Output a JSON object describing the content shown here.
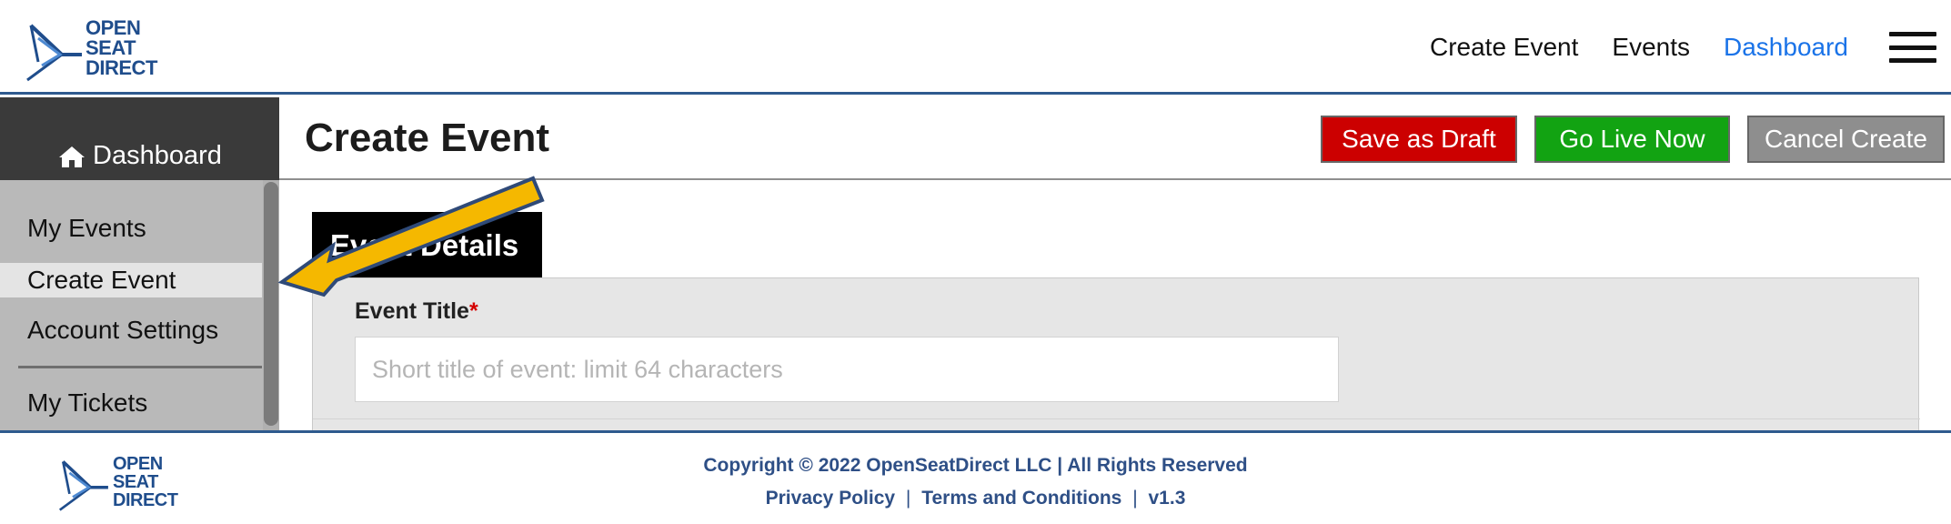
{
  "brand": {
    "logo_lines": [
      "OPEN",
      "SEAT",
      "DIRECT"
    ],
    "color": "#1f4d8c"
  },
  "topnav": {
    "items": [
      {
        "label": "Create Event"
      },
      {
        "label": "Events"
      },
      {
        "label": "Dashboard"
      }
    ],
    "active_color": "#1a73e8",
    "menu_icon": "hamburger-icon"
  },
  "sidebar": {
    "header_icon": "home-icon",
    "header_label": "Dashboard",
    "items": [
      {
        "label": "My Events"
      },
      {
        "label": "Create Event"
      },
      {
        "label": "Account Settings"
      },
      {
        "label": "My Tickets"
      }
    ],
    "active_item": "Create Event"
  },
  "main": {
    "title": "Create Event",
    "buttons": {
      "draft": "Save as Draft",
      "live": "Go Live Now",
      "cancel": "Cancel Create"
    },
    "button_colors": {
      "draft": "#cc0000",
      "live": "#12a312",
      "cancel": "#8e8e8e"
    },
    "section_tab": "Event Details",
    "event_title_label": "Event Title",
    "required_marker": "*",
    "event_title_placeholder": "Short title of event: limit 64 characters",
    "event_title_value": ""
  },
  "annotation": {
    "arrow_color": "#f5b800",
    "arrow_icon": "pointer-arrow-icon"
  },
  "footer": {
    "copyright": "Copyright © 2022 OpenSeatDirect LLC | All Rights Reserved",
    "privacy": "Privacy Policy",
    "separator": "|",
    "terms": "Terms and Conditions",
    "version": "v1.3"
  }
}
